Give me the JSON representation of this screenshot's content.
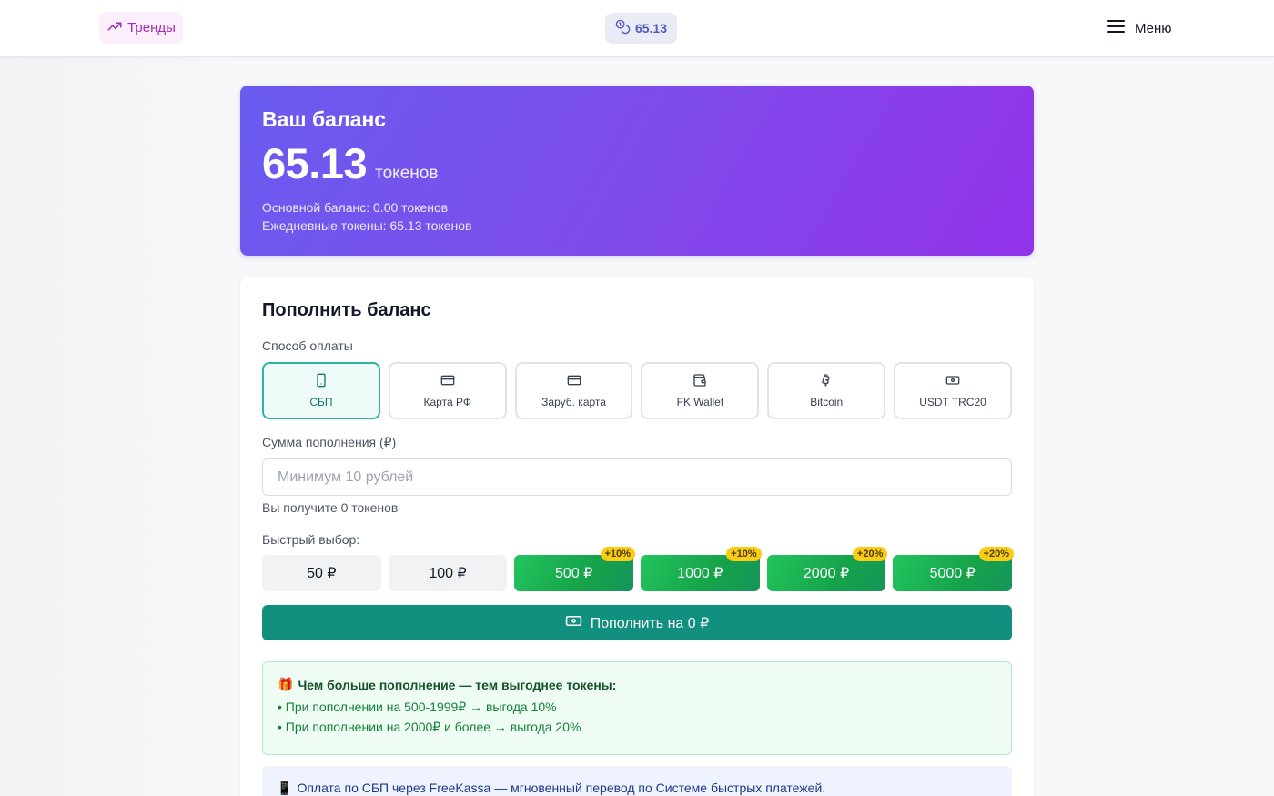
{
  "header": {
    "trends_label": "Тренды",
    "balance_chip": "65.13",
    "menu_label": "Меню"
  },
  "balance": {
    "title": "Ваш баланс",
    "amount": "65.13",
    "unit": "токенов",
    "main_balance": "Основной баланс: 0.00 токенов",
    "daily_tokens": "Ежедневные токены: 65.13 токенов"
  },
  "topup": {
    "title": "Пополнить баланс",
    "method_label": "Способ оплаты",
    "methods": [
      {
        "label": "СБП",
        "icon": "phone-icon",
        "active": true
      },
      {
        "label": "Карта РФ",
        "icon": "card-icon",
        "active": false
      },
      {
        "label": "Заруб. карта",
        "icon": "card-icon",
        "active": false
      },
      {
        "label": "FK Wallet",
        "icon": "wallet-icon",
        "active": false
      },
      {
        "label": "Bitcoin",
        "icon": "bitcoin-icon",
        "active": false
      },
      {
        "label": "USDT TRC20",
        "icon": "banknote-icon",
        "active": false
      }
    ],
    "amount_label": "Сумма пополнения (₽)",
    "amount_placeholder": "Минимум 10 рублей",
    "receive_text": "Вы получите 0 токенов",
    "quick_label": "Быстрый выбор:",
    "quick": [
      {
        "label": "50 ₽",
        "bonus": ""
      },
      {
        "label": "100 ₽",
        "bonus": ""
      },
      {
        "label": "500 ₽",
        "bonus": "+10%"
      },
      {
        "label": "1000 ₽",
        "bonus": "+10%"
      },
      {
        "label": "2000 ₽",
        "bonus": "+20%"
      },
      {
        "label": "5000 ₽",
        "bonus": "+20%"
      }
    ],
    "submit_label": "Пополнить на 0 ₽",
    "promo": {
      "emoji": "🎁",
      "title": "Чем больше пополнение — тем выгоднее токены:",
      "items": [
        "• При пополнении на 500-1999₽ → выгода 10%",
        "• При пополнении на 2000₽ и более → выгода 20%"
      ]
    },
    "sbp_note_emoji": "📱",
    "sbp_note": "Оплата по СБП через FreeKassa — мгновенный перевод по Системе быстрых платежей."
  },
  "colors": {
    "accent_teal": "#12907f",
    "gradient_start": "#6a5cf0",
    "gradient_end": "#9333ea",
    "bonus_green": "#16a34a",
    "badge_yellow": "#facc15"
  }
}
